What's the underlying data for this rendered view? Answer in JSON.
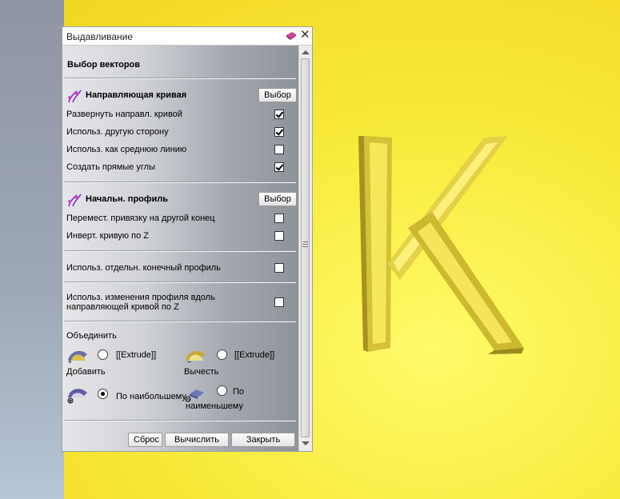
{
  "panel": {
    "title": "Выдавливание",
    "section_vectors": "Выбор векторов",
    "guide": {
      "header": "Направляющая кривая",
      "select_label": "Выбор",
      "options": [
        {
          "label": "Развернуть направл. кривой",
          "checked": true
        },
        {
          "label": "Использ. другую сторону",
          "checked": true
        },
        {
          "label": "Использ. как среднюю линию",
          "checked": false
        },
        {
          "label": "Создать прямые углы",
          "checked": true
        }
      ]
    },
    "profile": {
      "header": "Начальн. профиль",
      "select_label": "Выбор",
      "options": [
        {
          "label": "Перемест. привязку на другой конец",
          "checked": false
        },
        {
          "label": "Инверт. кривую по Z",
          "checked": false
        }
      ]
    },
    "end_profile": {
      "label": "Использ. отдельн. конечный профиль",
      "checked": false
    },
    "profile_change": {
      "line1": "Использ. изменения профиля вдоль",
      "line2": "направляющей кривой по Z",
      "checked": false
    },
    "combine": {
      "header": "Объединить",
      "add": {
        "name": "[[Extrude]]",
        "label": "Добавить"
      },
      "subtract": {
        "name": "[[Extrude]]",
        "label": "Вычесть"
      },
      "max": {
        "label": "По наибольшему"
      },
      "min": {
        "line1": "По",
        "line2": "наименьшему"
      }
    },
    "footer": {
      "reset": "Сброс",
      "compute": "Вычислить",
      "close": "Закрыть"
    }
  }
}
